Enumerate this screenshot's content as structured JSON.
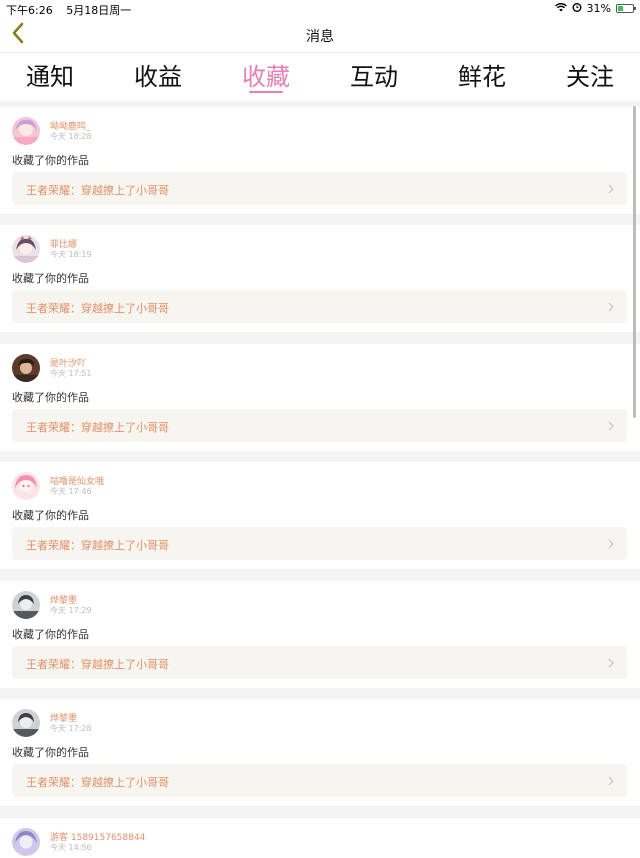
{
  "status_bar": {
    "time": "下午6:26",
    "date": "5月18日周一",
    "battery": "31%",
    "icons": [
      "wifi-icon",
      "alarm-icon",
      "battery-icon"
    ]
  },
  "nav": {
    "title": "消息",
    "back_icon": "chevron-left-icon"
  },
  "tabs": [
    {
      "label": "通知",
      "active": false
    },
    {
      "label": "收益",
      "active": false
    },
    {
      "label": "收藏",
      "active": true
    },
    {
      "label": "互动",
      "active": false
    },
    {
      "label": "鲜花",
      "active": false
    },
    {
      "label": "关注",
      "active": false
    }
  ],
  "colors": {
    "accent": "#e77fb3",
    "name_color": "#e3906a",
    "work_bg": "#f6f5ef"
  },
  "notifications": [
    {
      "name": "呦呦鹿鸣_",
      "time": "今天 18:28",
      "action": "收藏了你的作品",
      "work": "王者荣耀：穿越撩上了小哥哥"
    },
    {
      "name": "菲比娜",
      "time": "今天 18:19",
      "action": "收藏了你的作品",
      "work": "王者荣耀：穿越撩上了小哥哥"
    },
    {
      "name": "是叶汐吖",
      "time": "今天 17:51",
      "action": "收藏了你的作品",
      "work": "王者荣耀：穿越撩上了小哥哥"
    },
    {
      "name": "咕噜是仙女哦",
      "time": "今天 17:46",
      "action": "收藏了你的作品",
      "work": "王者荣耀：穿越撩上了小哥哥"
    },
    {
      "name": "烨黎墨",
      "time": "今天 17:29",
      "action": "收藏了你的作品",
      "work": "王者荣耀：穿越撩上了小哥哥"
    },
    {
      "name": "烨黎墨",
      "time": "今天 17:28",
      "action": "收藏了你的作品",
      "work": "王者荣耀：穿越撩上了小哥哥"
    },
    {
      "name": "游客 1589157658844",
      "time": "今天 14:56",
      "action": "",
      "work": ""
    }
  ]
}
